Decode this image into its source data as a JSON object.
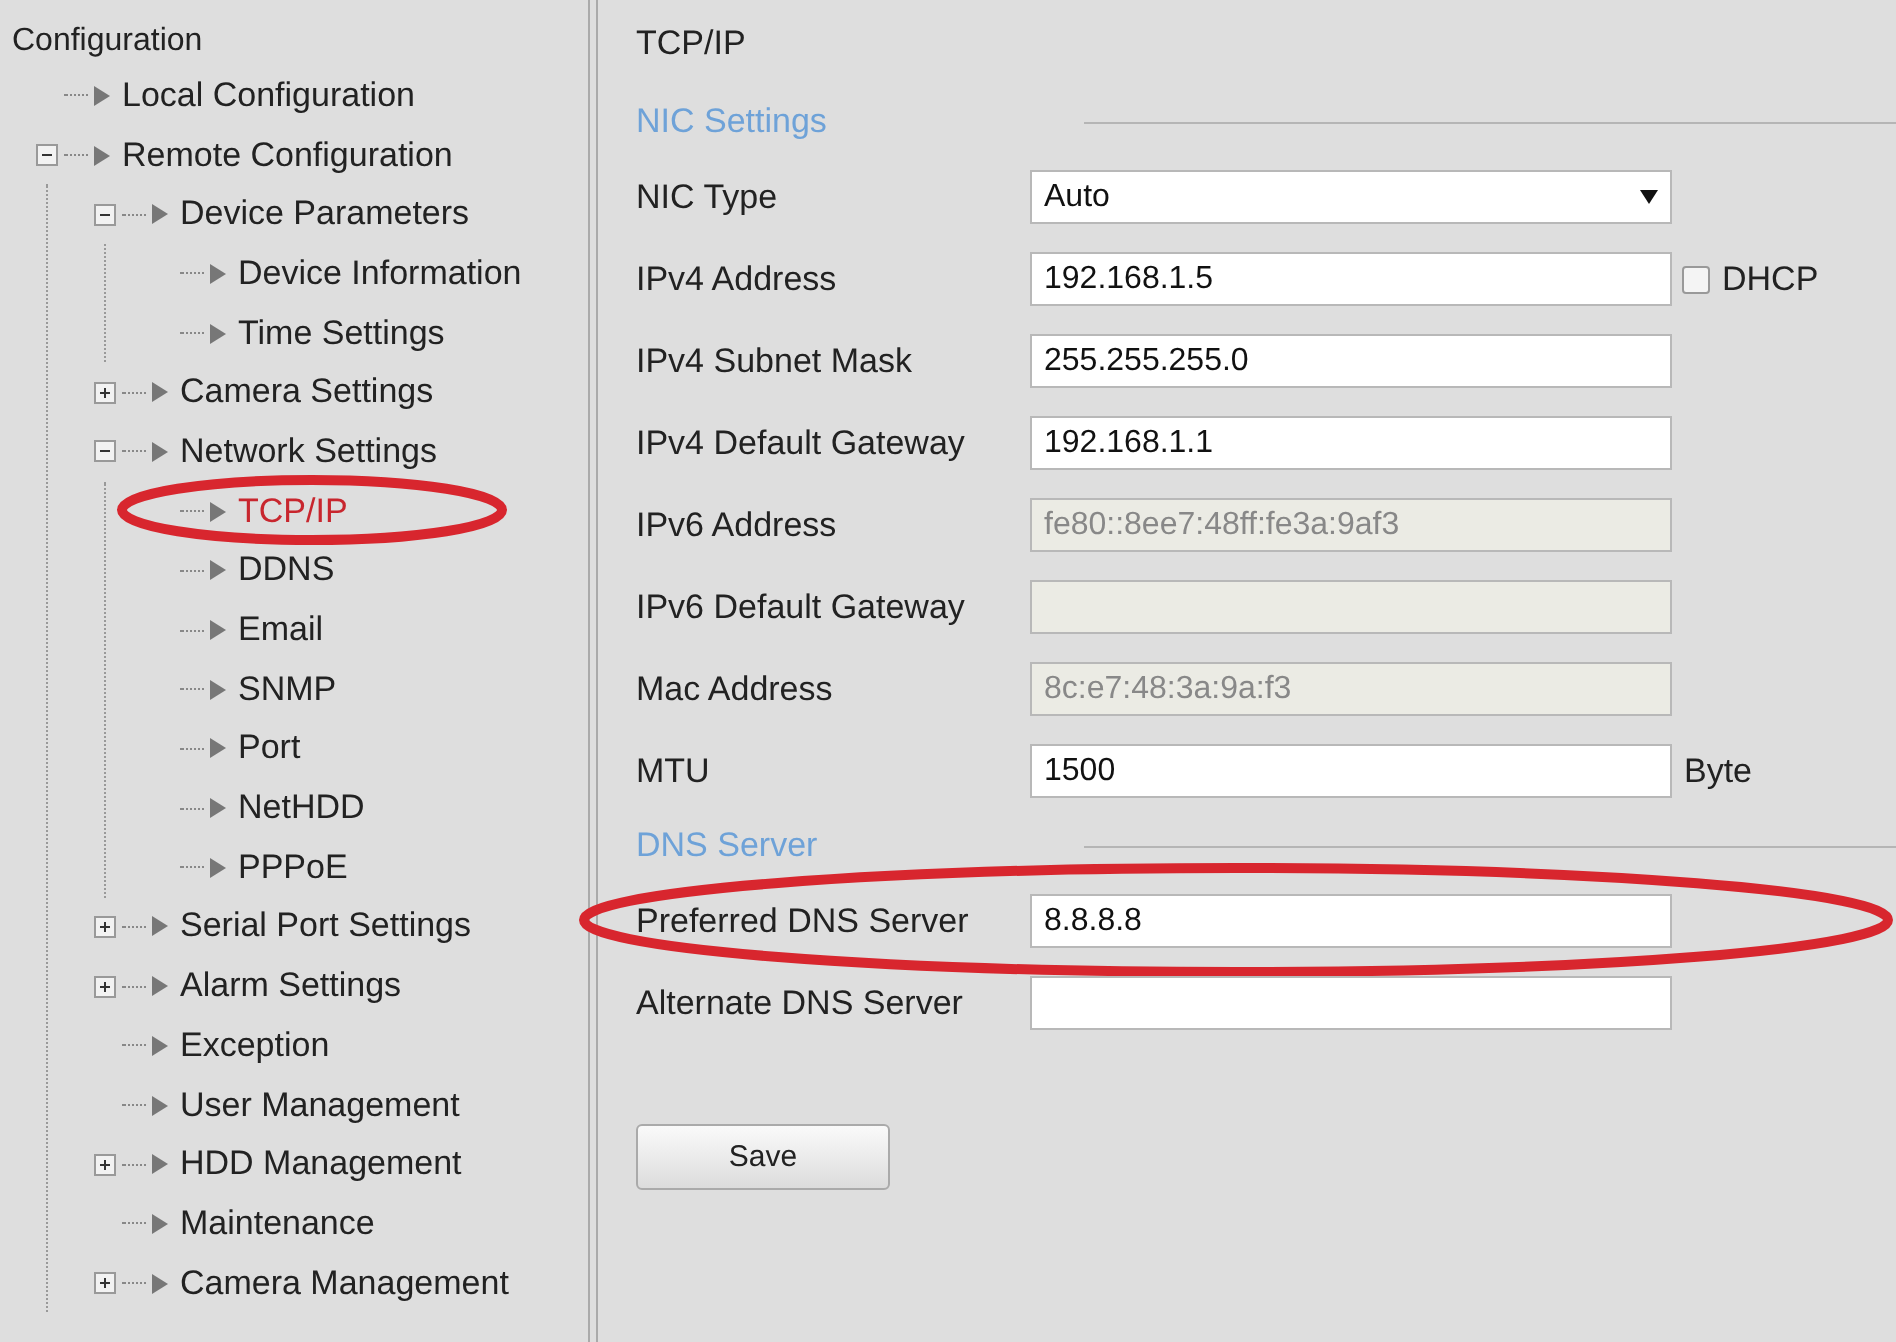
{
  "sidebar": {
    "title": "Configuration",
    "tree": [
      {
        "label": "Local Configuration",
        "selected": false,
        "circled": false
      },
      {
        "label": "Remote Configuration",
        "expanded": true,
        "selected": false,
        "circled": false,
        "children": [
          {
            "label": "Device Parameters",
            "expanded": true,
            "selected": false,
            "circled": false,
            "children": [
              {
                "label": "Device Information",
                "selected": false,
                "circled": false
              },
              {
                "label": "Time Settings",
                "selected": false,
                "circled": false
              }
            ]
          },
          {
            "label": "Camera Settings",
            "expanded": false,
            "selected": false,
            "circled": false
          },
          {
            "label": "Network Settings",
            "expanded": true,
            "selected": false,
            "circled": false,
            "children": [
              {
                "label": "TCP/IP",
                "selected": true,
                "circled": true
              },
              {
                "label": "DDNS",
                "selected": false,
                "circled": false
              },
              {
                "label": "Email",
                "selected": false,
                "circled": false
              },
              {
                "label": "SNMP",
                "selected": false,
                "circled": false
              },
              {
                "label": "Port",
                "selected": false,
                "circled": false
              },
              {
                "label": "NetHDD",
                "selected": false,
                "circled": false
              },
              {
                "label": "PPPoE",
                "selected": false,
                "circled": false
              }
            ]
          },
          {
            "label": "Serial Port Settings",
            "expanded": false,
            "selected": false,
            "circled": false
          },
          {
            "label": "Alarm Settings",
            "expanded": false,
            "selected": false,
            "circled": false
          },
          {
            "label": "Exception",
            "selected": false,
            "circled": false
          },
          {
            "label": "User Management",
            "selected": false,
            "circled": false
          },
          {
            "label": "HDD Management",
            "expanded": false,
            "selected": false,
            "circled": false
          },
          {
            "label": "Maintenance",
            "selected": false,
            "circled": false
          },
          {
            "label": "Camera Management",
            "expanded": false,
            "selected": false,
            "circled": false
          }
        ]
      }
    ]
  },
  "panel": {
    "title": "TCP/IP",
    "sections": [
      {
        "heading": "NIC Settings",
        "fields": [
          {
            "label": "NIC Type",
            "kind": "select",
            "value": "Auto",
            "disabled": false,
            "circled": false
          },
          {
            "label": "IPv4 Address",
            "kind": "input",
            "value": "192.168.1.5",
            "disabled": false,
            "circled": false,
            "checkbox": {
              "label": "DHCP",
              "checked": false
            }
          },
          {
            "label": "IPv4 Subnet Mask",
            "kind": "input",
            "value": "255.255.255.0",
            "disabled": false,
            "circled": false
          },
          {
            "label": "IPv4 Default Gateway",
            "kind": "input",
            "value": "192.168.1.1",
            "disabled": false,
            "circled": false
          },
          {
            "label": "IPv6 Address",
            "kind": "input",
            "value": "fe80::8ee7:48ff:fe3a:9af3",
            "disabled": true,
            "circled": false
          },
          {
            "label": "IPv6 Default Gateway",
            "kind": "input",
            "disabled": true,
            "circled": false
          },
          {
            "label": "Mac Address",
            "kind": "input",
            "value": "8c:e7:48:3a:9a:f3",
            "disabled": true,
            "circled": false
          },
          {
            "label": "MTU",
            "kind": "input",
            "value": "1500",
            "disabled": false,
            "circled": false,
            "suffix": "Byte"
          }
        ]
      },
      {
        "heading": "DNS Server",
        "fields": [
          {
            "label": "Preferred DNS Server",
            "kind": "input",
            "value": "8.8.8.8",
            "disabled": false,
            "circled": true
          },
          {
            "label": "Alternate DNS Server",
            "kind": "input",
            "disabled": false,
            "circled": false
          }
        ]
      }
    ],
    "save_button": "Save"
  }
}
